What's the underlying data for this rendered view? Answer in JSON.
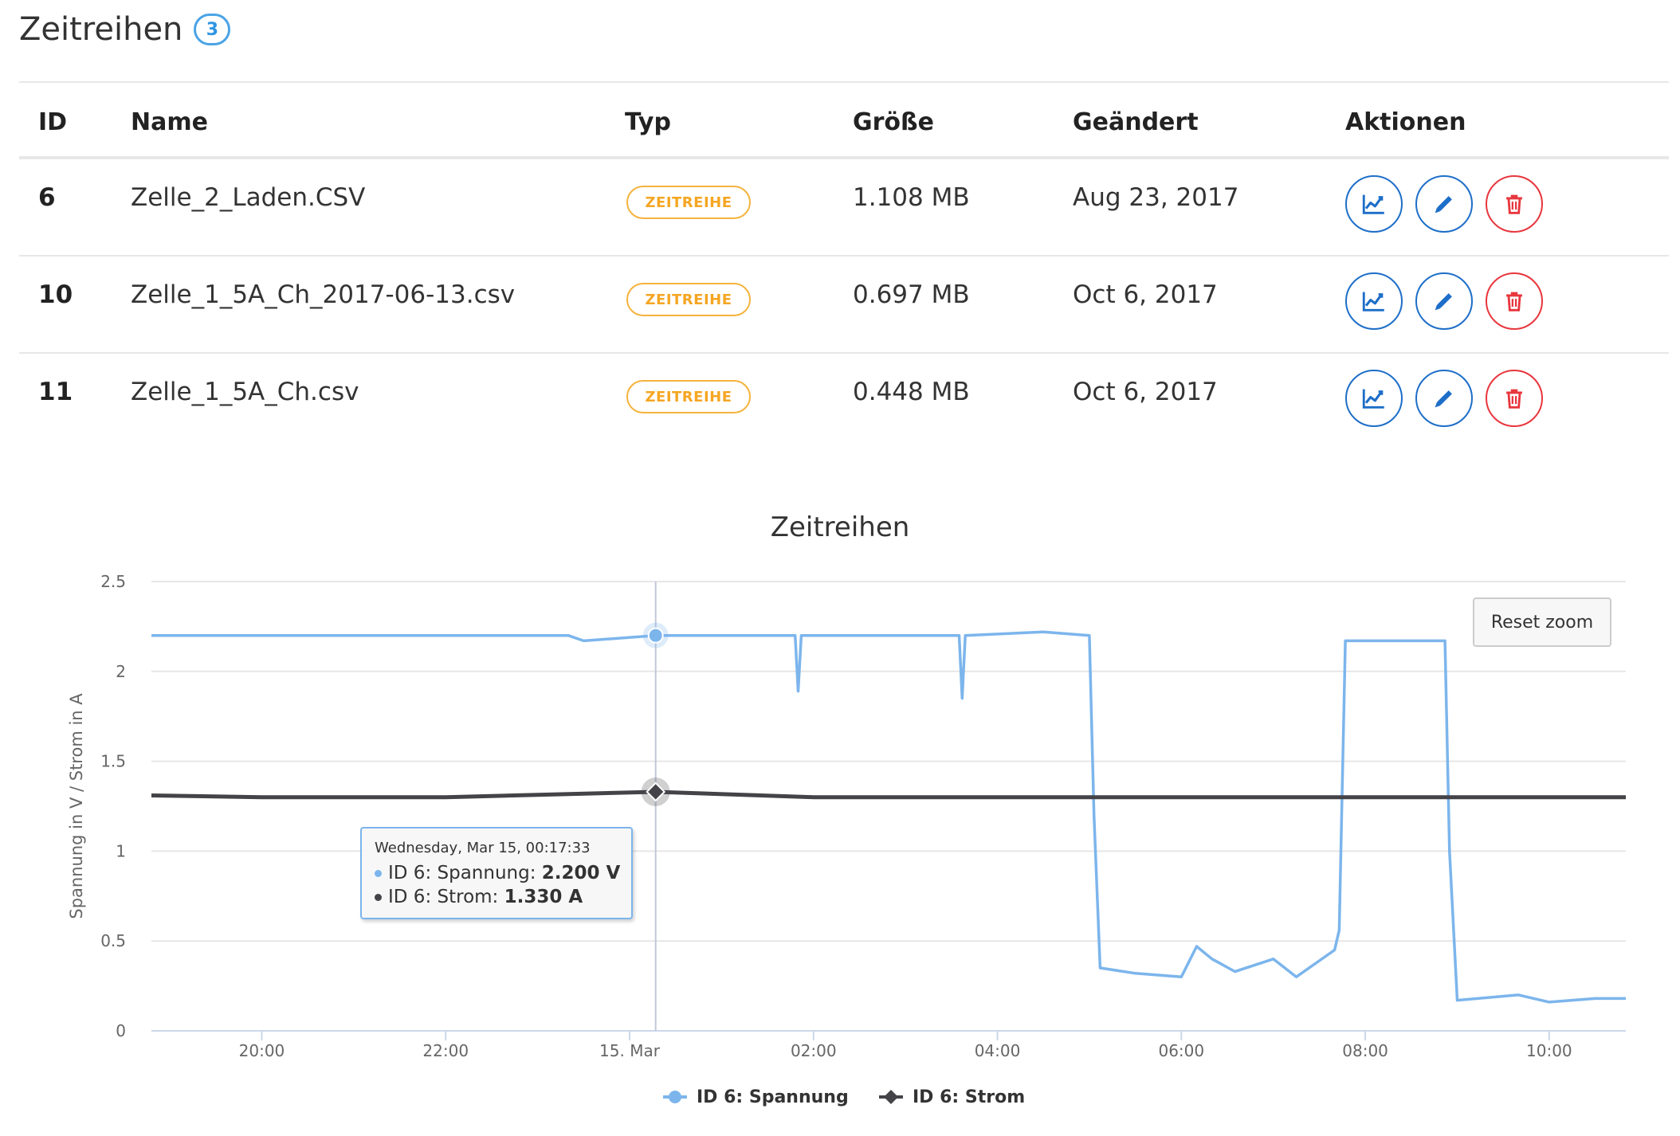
{
  "header": {
    "title": "Zeitreihen",
    "count": "3"
  },
  "table": {
    "columns": [
      "ID",
      "Name",
      "Typ",
      "Größe",
      "Geändert",
      "Aktionen"
    ],
    "rows": [
      {
        "id": "6",
        "name": "Zelle_2_Laden.CSV",
        "type": "ZEITREIHE",
        "size": "1.108 MB",
        "date": "Aug 23, 2017"
      },
      {
        "id": "10",
        "name": "Zelle_1_5A_Ch_2017-06-13.csv",
        "type": "ZEITREIHE",
        "size": "0.697 MB",
        "date": "Oct 6, 2017"
      },
      {
        "id": "11",
        "name": "Zelle_1_5A_Ch.csv",
        "type": "ZEITREIHE",
        "size": "0.448 MB",
        "date": "Oct 6, 2017"
      }
    ],
    "action_icons": [
      "chart-line-icon",
      "pencil-icon",
      "trash-icon"
    ]
  },
  "chart": {
    "reset_zoom_label": "Reset zoom",
    "tooltip": {
      "title": "Wednesday, Mar 15, 00:17:33",
      "rows": [
        {
          "prefix": "ID 6: Spannung: ",
          "value": "2.200 V",
          "color": "#7cb5ec"
        },
        {
          "prefix": "ID 6: Strom: ",
          "value": "1.330 A",
          "color": "#434348"
        }
      ]
    }
  },
  "colors": {
    "accent": "#2f95e0",
    "action_blue": "#1d6ec8",
    "delete_red": "#e8363d",
    "badge_orange": "#f5a623",
    "series_spannung": "#7cb5ec",
    "series_strom": "#434348"
  },
  "chart_data": {
    "type": "line",
    "title": "Zeitreihen",
    "xlabel": "",
    "ylabel": "Spannung in V / Strom in A",
    "ylim": [
      0,
      2.5
    ],
    "xlim": [
      "2017-03-14 18:48",
      "2017-03-15 10:50"
    ],
    "y_ticks": [
      "0",
      "0.5",
      "1",
      "1.5",
      "2",
      "2.5"
    ],
    "x_ticks": [
      {
        "time": "2017-03-14 20:00",
        "label": "20:00"
      },
      {
        "time": "2017-03-14 22:00",
        "label": "22:00"
      },
      {
        "time": "2017-03-15 00:00",
        "label": "15. Mar"
      },
      {
        "time": "2017-03-15 02:00",
        "label": "02:00"
      },
      {
        "time": "2017-03-15 04:00",
        "label": "04:00"
      },
      {
        "time": "2017-03-15 06:00",
        "label": "06:00"
      },
      {
        "time": "2017-03-15 08:00",
        "label": "08:00"
      },
      {
        "time": "2017-03-15 10:00",
        "label": "10:00"
      }
    ],
    "grid": true,
    "legend_position": "bottom-center",
    "crosshair_time": "2017-03-15 00:17",
    "series": [
      {
        "name": "ID 6: Spannung",
        "color": "#7cb5ec",
        "marker": "circle",
        "x": [
          "2017-03-14 18:48",
          "2017-03-14 20:00",
          "2017-03-14 22:00",
          "2017-03-14 23:20",
          "2017-03-14 23:30",
          "2017-03-15 00:17",
          "2017-03-15 01:48",
          "2017-03-15 01:50",
          "2017-03-15 01:52",
          "2017-03-15 03:35",
          "2017-03-15 03:37",
          "2017-03-15 03:39",
          "2017-03-15 04:30",
          "2017-03-15 05:00",
          "2017-03-15 05:03",
          "2017-03-15 05:07",
          "2017-03-15 05:30",
          "2017-03-15 06:00",
          "2017-03-15 06:10",
          "2017-03-15 06:20",
          "2017-03-15 06:35",
          "2017-03-15 07:00",
          "2017-03-15 07:15",
          "2017-03-15 07:40",
          "2017-03-15 07:43",
          "2017-03-15 07:47",
          "2017-03-15 08:00",
          "2017-03-15 08:30",
          "2017-03-15 08:52",
          "2017-03-15 08:55",
          "2017-03-15 09:00",
          "2017-03-15 09:40",
          "2017-03-15 10:00",
          "2017-03-15 10:30",
          "2017-03-15 10:50"
        ],
        "y": [
          2.2,
          2.2,
          2.2,
          2.2,
          2.17,
          2.2,
          2.2,
          1.89,
          2.2,
          2.2,
          1.85,
          2.2,
          2.22,
          2.2,
          1.2,
          0.35,
          0.32,
          0.3,
          0.47,
          0.4,
          0.33,
          0.4,
          0.3,
          0.45,
          0.56,
          2.17,
          2.17,
          2.17,
          2.17,
          1.0,
          0.17,
          0.2,
          0.16,
          0.18,
          0.18
        ]
      },
      {
        "name": "ID 6: Strom",
        "color": "#434348",
        "marker": "diamond",
        "x": [
          "2017-03-14 18:48",
          "2017-03-14 20:00",
          "2017-03-14 22:00",
          "2017-03-15 00:17",
          "2017-03-15 02:00",
          "2017-03-15 04:00",
          "2017-03-15 06:00",
          "2017-03-15 08:00",
          "2017-03-15 10:00",
          "2017-03-15 10:50"
        ],
        "y": [
          1.31,
          1.3,
          1.3,
          1.33,
          1.3,
          1.3,
          1.3,
          1.3,
          1.3,
          1.3
        ]
      }
    ]
  }
}
